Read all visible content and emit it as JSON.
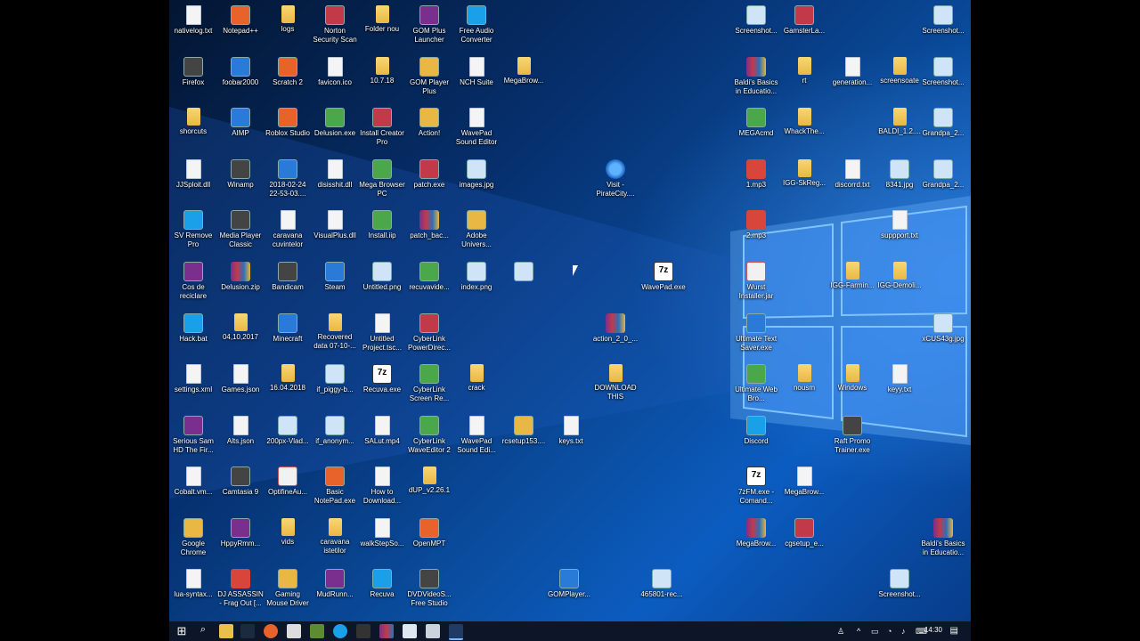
{
  "colors": {
    "desktop_bg": "#0a4fa3",
    "taskbar_bg": "#0c1628"
  },
  "desktop": {
    "icons": [
      {
        "label": "nativelog.txt",
        "glyph": "file"
      },
      {
        "label": "Notepad++",
        "glyph": "exe"
      },
      {
        "label": "logs",
        "glyph": "folder"
      },
      {
        "label": "Norton Security Scan",
        "glyph": "exe"
      },
      {
        "label": "Folder nou",
        "glyph": "folder"
      },
      {
        "label": "GOM Plus Launcher",
        "glyph": "exe"
      },
      {
        "label": "Free Audio Converter",
        "glyph": "exe"
      },
      {
        "label": "Firefox",
        "glyph": "exe"
      },
      {
        "label": "foobar2000",
        "glyph": "exe"
      },
      {
        "label": "Scratch 2",
        "glyph": "exe"
      },
      {
        "label": "favicon.ico",
        "glyph": "file"
      },
      {
        "label": "10.7.18",
        "glyph": "folder"
      },
      {
        "label": "GOM Player Plus",
        "glyph": "exe"
      },
      {
        "label": "NCH Suite",
        "glyph": "file"
      },
      {
        "label": "MegaBrow...",
        "glyph": "folder"
      },
      {
        "label": "shorcuts",
        "glyph": "folder"
      },
      {
        "label": "AIMP",
        "glyph": "exe"
      },
      {
        "label": "Roblox Studio",
        "glyph": "exe"
      },
      {
        "label": "Delusion.exe",
        "glyph": "exe"
      },
      {
        "label": "Install Creator Pro",
        "glyph": "exe"
      },
      {
        "label": "Action!",
        "glyph": "exe"
      },
      {
        "label": "WavePad Sound Editor",
        "glyph": "file"
      },
      {
        "label": "JJSploit.dll",
        "glyph": "file"
      },
      {
        "label": "Winamp",
        "glyph": "exe"
      },
      {
        "label": "2018-02-24 22-53-03....",
        "glyph": "exe"
      },
      {
        "label": "disisshit.dll",
        "glyph": "file"
      },
      {
        "label": "Mega Browser PC",
        "glyph": "exe"
      },
      {
        "label": "patch.exe",
        "glyph": "exe"
      },
      {
        "label": "images.jpg",
        "glyph": "png"
      },
      {
        "label": "Visit - PirateCity....",
        "glyph": "ie"
      },
      {
        "label": "SV Remove Pro",
        "glyph": "exe"
      },
      {
        "label": "Media Player Classic",
        "glyph": "exe"
      },
      {
        "label": "caravana cuvintelor",
        "glyph": "file"
      },
      {
        "label": "VisualPlus.dll",
        "glyph": "file"
      },
      {
        "label": "Install.iip",
        "glyph": "exe"
      },
      {
        "label": "patch_bac...",
        "glyph": "winrar"
      },
      {
        "label": "Adobe Univers...",
        "glyph": "exe"
      },
      {
        "label": "Cos de reciclare",
        "glyph": "exe"
      },
      {
        "label": "Delusion.zip",
        "glyph": "winrar"
      },
      {
        "label": "Bandicam",
        "glyph": "exe"
      },
      {
        "label": "Steam",
        "glyph": "exe"
      },
      {
        "label": "Untitled.png",
        "glyph": "png"
      },
      {
        "label": "recuvavide...",
        "glyph": "exe"
      },
      {
        "label": "index.png",
        "glyph": "png"
      },
      {
        "label": "",
        "glyph": "png"
      },
      {
        "label": "WavePad.exe",
        "glyph": "7z"
      },
      {
        "label": "Hack.bat",
        "glyph": "exe"
      },
      {
        "label": "04,10,2017",
        "glyph": "folder"
      },
      {
        "label": "Minecraft",
        "glyph": "exe"
      },
      {
        "label": "Recovered data 07-10-...",
        "glyph": "folder"
      },
      {
        "label": "Untitled Project.tsc...",
        "glyph": "file"
      },
      {
        "label": "CyberLink PowerDirec...",
        "glyph": "exe"
      },
      {
        "label": "action_2_0_...",
        "glyph": "winrar"
      },
      {
        "label": "settings.xml",
        "glyph": "file"
      },
      {
        "label": "Games.json",
        "glyph": "file"
      },
      {
        "label": "16.04.2018",
        "glyph": "folder"
      },
      {
        "label": "if_piggy-b...",
        "glyph": "png"
      },
      {
        "label": "Recuva.exe",
        "glyph": "7z"
      },
      {
        "label": "CyberLink Screen Re...",
        "glyph": "exe"
      },
      {
        "label": "crack",
        "glyph": "folder"
      },
      {
        "label": "DOWNLOAD THIS",
        "glyph": "folder"
      },
      {
        "label": "Serious Sam HD The Fir...",
        "glyph": "exe"
      },
      {
        "label": "Alts.json",
        "glyph": "file"
      },
      {
        "label": "200px-Vlad...",
        "glyph": "png"
      },
      {
        "label": "if_anonym...",
        "glyph": "png"
      },
      {
        "label": "SALut.mp4",
        "glyph": "file"
      },
      {
        "label": "CyberLink WaveEditor 2",
        "glyph": "exe"
      },
      {
        "label": "WavePad Sound Edi...",
        "glyph": "file"
      },
      {
        "label": "rcsetup153....",
        "glyph": "exe"
      },
      {
        "label": "keys.txt",
        "glyph": "file"
      },
      {
        "label": "Cobalt.vm...",
        "glyph": "file"
      },
      {
        "label": "Camtasia 9",
        "glyph": "exe"
      },
      {
        "label": "OptifineAu...",
        "glyph": "jar"
      },
      {
        "label": "Basic NotePad.exe",
        "glyph": "exe"
      },
      {
        "label": "How to Download...",
        "glyph": "file"
      },
      {
        "label": "dUP_v2.26.1",
        "glyph": "folder"
      },
      {
        "label": "Google Chrome",
        "glyph": "exe"
      },
      {
        "label": "HppyRmm...",
        "glyph": "exe"
      },
      {
        "label": "vids",
        "glyph": "folder"
      },
      {
        "label": "caravana istetilor",
        "glyph": "folder"
      },
      {
        "label": "walkStepSo...",
        "glyph": "file"
      },
      {
        "label": "OpenMPT",
        "glyph": "exe"
      },
      {
        "label": "lua-syntax...",
        "glyph": "file"
      },
      {
        "label": "DJ ASSASSIN - Frag Out [...",
        "glyph": "mp3"
      },
      {
        "label": "Gaming Mouse Driver",
        "glyph": "exe"
      },
      {
        "label": "MudRunn...",
        "glyph": "exe"
      },
      {
        "label": "Recuva",
        "glyph": "exe"
      },
      {
        "label": "DVDVideoS... Free Studio",
        "glyph": "exe"
      },
      {
        "label": "GOMPlayer...",
        "glyph": "exe"
      },
      {
        "label": "465801-rec...",
        "glyph": "png"
      },
      {
        "label": "Screenshot...",
        "glyph": "png"
      },
      {
        "label": "GamsterLa...",
        "glyph": "exe"
      },
      {
        "label": "Screenshot...",
        "glyph": "png"
      },
      {
        "label": "Baldi's Basics in Educatio...",
        "glyph": "winrar"
      },
      {
        "label": "rt",
        "glyph": "folder"
      },
      {
        "label": "generation...",
        "glyph": "file"
      },
      {
        "label": "screensoate",
        "glyph": "folder"
      },
      {
        "label": "Screenshot...",
        "glyph": "png"
      },
      {
        "label": "MEGAcmd",
        "glyph": "exe"
      },
      {
        "label": "WhackThe...",
        "glyph": "folder"
      },
      {
        "label": "BALDI_1.2....",
        "glyph": "folder"
      },
      {
        "label": "Grandpa_2...",
        "glyph": "png"
      },
      {
        "label": "1.mp3",
        "glyph": "mp3"
      },
      {
        "label": "IGG-SkReg...",
        "glyph": "folder"
      },
      {
        "label": "discorrd.txt",
        "glyph": "file"
      },
      {
        "label": "8341.jpg",
        "glyph": "png"
      },
      {
        "label": "Grandpa_2...",
        "glyph": "png"
      },
      {
        "label": "2.mp3",
        "glyph": "mp3"
      },
      {
        "label": "suppport.txt",
        "glyph": "file"
      },
      {
        "label": "Wurst Installer.jar",
        "glyph": "jar"
      },
      {
        "label": "IGG-Farmin...",
        "glyph": "folder"
      },
      {
        "label": "IGG-Demoli...",
        "glyph": "folder"
      },
      {
        "label": "Ultimate Text Saver.exe",
        "glyph": "exe"
      },
      {
        "label": "xCUS43g.jpg",
        "glyph": "png"
      },
      {
        "label": "Ultimate Web Bro...",
        "glyph": "exe"
      },
      {
        "label": "nousm",
        "glyph": "folder"
      },
      {
        "label": "Windows",
        "glyph": "folder"
      },
      {
        "label": "keyy.txt",
        "glyph": "file"
      },
      {
        "label": "Discord",
        "glyph": "exe"
      },
      {
        "label": "Raft Promo Trainer.exe",
        "glyph": "exe"
      },
      {
        "label": "7zFM.exe - Comand...",
        "glyph": "7z"
      },
      {
        "label": "MegaBrow...",
        "glyph": "file"
      },
      {
        "label": "MegaBrow...",
        "glyph": "winrar"
      },
      {
        "label": "cgsetup_e...",
        "glyph": "exe"
      },
      {
        "label": "Baldi's Basics in Educatio...",
        "glyph": "winrar"
      },
      {
        "label": "Screenshot...",
        "glyph": "png"
      }
    ]
  },
  "taskbar": {
    "start_label": "Start",
    "apps": [
      "search-icon",
      "file-explorer-icon",
      "pin-icon",
      "firefox-icon",
      "mail-icon",
      "minecraft-icon",
      "skype-icon",
      "settings-icon",
      "winrar-icon",
      "notepad-icon",
      "calculator-icon",
      "cmd-icon"
    ],
    "tray_icons": [
      "person-icon",
      "chevron-up-icon",
      "usb-icon",
      "wifi-icon",
      "volume-icon",
      "keyboard-icon"
    ],
    "clock": "14:30"
  }
}
